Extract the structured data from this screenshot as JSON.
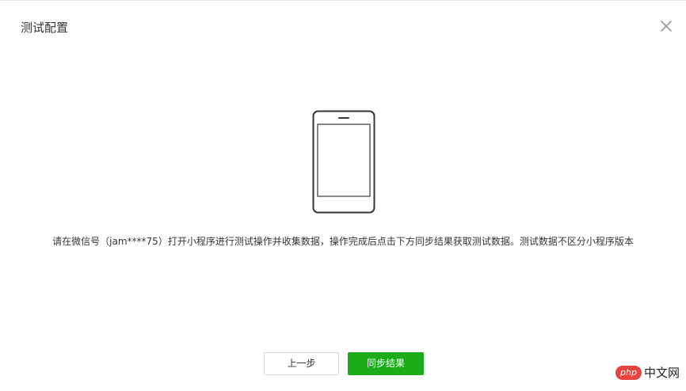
{
  "dialog": {
    "title": "测试配置",
    "close_icon": "close-icon",
    "illustration_icon": "phone-icon",
    "message": "请在微信号（jam****75）打开小程序进行测试操作并收集数据，操作完成后点击下方同步结果获取测试数据。测试数据不区分小程序版本",
    "buttons": {
      "prev_label": "上一步",
      "sync_label": "同步结果"
    },
    "colors": {
      "primary": "#1aad19",
      "text": "#353535",
      "icon": "#999999"
    }
  },
  "watermark": {
    "logo_text": "php",
    "site_text": "中文网"
  }
}
